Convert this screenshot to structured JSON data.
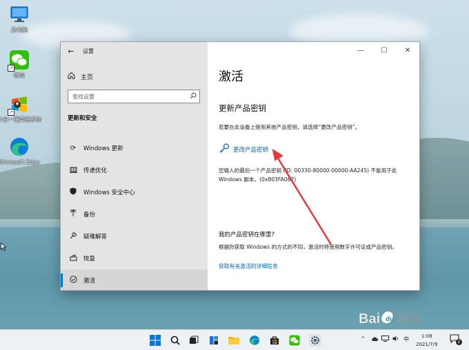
{
  "desktop": {
    "icons": [
      {
        "label": "此电脑",
        "icon": "computer-icon"
      },
      {
        "label": "微信",
        "icon": "wechat-icon"
      },
      {
        "label": "小白一键重装系统",
        "icon": "reinstall-tool-icon"
      },
      {
        "label": "Microsoft Edge",
        "icon": "edge-icon"
      }
    ]
  },
  "window": {
    "app_title": "设置",
    "controls": {
      "minimize": "—",
      "maximize": "☐",
      "close": "✕"
    }
  },
  "sidebar": {
    "home_label": "主页",
    "search_placeholder": "查找设置",
    "section_title": "更新和安全",
    "items": [
      {
        "label": "Windows 更新",
        "icon": "sync-icon"
      },
      {
        "label": "传递优化",
        "icon": "delivery-optimization-icon"
      },
      {
        "label": "Windows 安全中心",
        "icon": "shield-icon"
      },
      {
        "label": "备份",
        "icon": "backup-icon"
      },
      {
        "label": "疑难解答",
        "icon": "wrench-icon"
      },
      {
        "label": "恢复",
        "icon": "recovery-icon"
      },
      {
        "label": "激活",
        "icon": "check-circle-icon",
        "active": true
      }
    ]
  },
  "main": {
    "page_title": "激活",
    "subtitle": "更新产品密钥",
    "description": "若要在此设备上使用其他产品密钥，请选择“更改产品密钥”。",
    "change_key_label": "更改产品密钥",
    "error_text": "您输入的最后一个产品密钥 (ID: 00330-80000-00000-AA245) 不能用于此 Windows 副本。(0x803FA067)",
    "where_title": "我的产品密钥在哪里?",
    "where_description": "根据你获取 Windows 的方式的不同，激活时将使用数字许可证或产品密钥。",
    "more_info_link": "获取有关激活的详细信息"
  },
  "taskbar": {
    "tray_chevron": "^",
    "ime_label": "中",
    "time": "1:08",
    "date": "2021/7/9",
    "notification_count": "2"
  },
  "watermark": {
    "text": "Bai 经验"
  },
  "colors": {
    "accent": "#0078d4",
    "link": "#0067c0",
    "annotation_arrow": "#e8373b"
  }
}
